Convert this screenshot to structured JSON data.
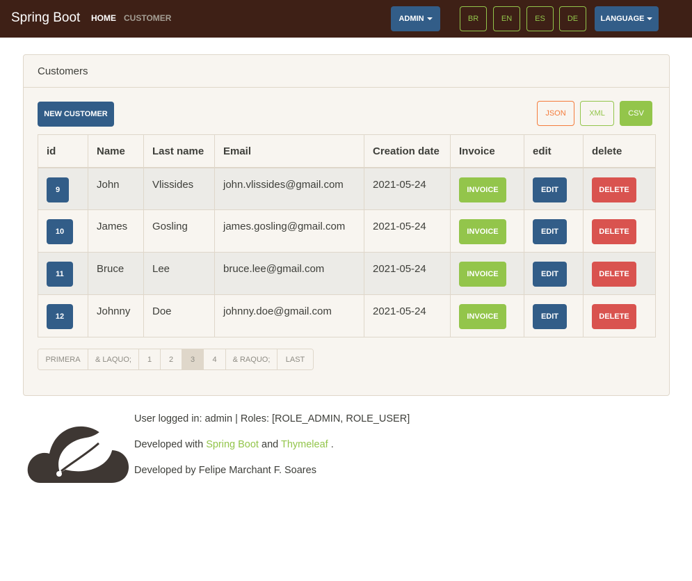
{
  "navbar": {
    "brand": "Spring Boot",
    "home": "HOME",
    "customer": "CUSTOMER",
    "admin": "ADMIN",
    "languages": [
      "BR",
      "EN",
      "ES",
      "DE"
    ],
    "language": "LANGUAGE"
  },
  "card": {
    "title": "Customers",
    "new_customer": "NEW CUSTOMER",
    "export": {
      "json": "JSON",
      "xml": "XML",
      "csv": "CSV"
    }
  },
  "table": {
    "headers": [
      "id",
      "Name",
      "Last name",
      "Email",
      "Creation date",
      "Invoice",
      "edit",
      "delete"
    ],
    "invoice_label": "INVOICE",
    "edit_label": "EDIT",
    "delete_label": "DELETE",
    "rows": [
      {
        "id": "9",
        "name": "John",
        "last_name": "Vlissides",
        "email": "john.vlissides@gmail.com",
        "created": "2021-05-24"
      },
      {
        "id": "10",
        "name": "James",
        "last_name": "Gosling",
        "email": "james.gosling@gmail.com",
        "created": "2021-05-24"
      },
      {
        "id": "11",
        "name": "Bruce",
        "last_name": "Lee",
        "email": "bruce.lee@gmail.com",
        "created": "2021-05-24"
      },
      {
        "id": "12",
        "name": "Johnny",
        "last_name": "Doe",
        "email": "johnny.doe@gmail.com",
        "created": "2021-05-24"
      }
    ]
  },
  "pagination": {
    "items": [
      "PRIMERA",
      "& LAQUO;",
      "1",
      "2",
      "3",
      "4",
      "& RAQUO;",
      "LAST"
    ],
    "active": "3"
  },
  "footer": {
    "logged_in": "User logged in: admin | Roles: [ROLE_ADMIN, ROLE_USER]",
    "developed_with_prefix": "Developed with",
    "spring_boot_link": "Spring Boot",
    "and": "and",
    "thymeleaf_link": "Thymeleaf",
    "period": ".",
    "developed_by": "Developed by Felipe Marchant F. Soares"
  },
  "colors": {
    "navbar": "#3e2016",
    "primary": "#325d88",
    "success": "#93c54b",
    "danger": "#d9534f",
    "warning": "#f47c3c",
    "card_bg": "#f8f5f0"
  }
}
